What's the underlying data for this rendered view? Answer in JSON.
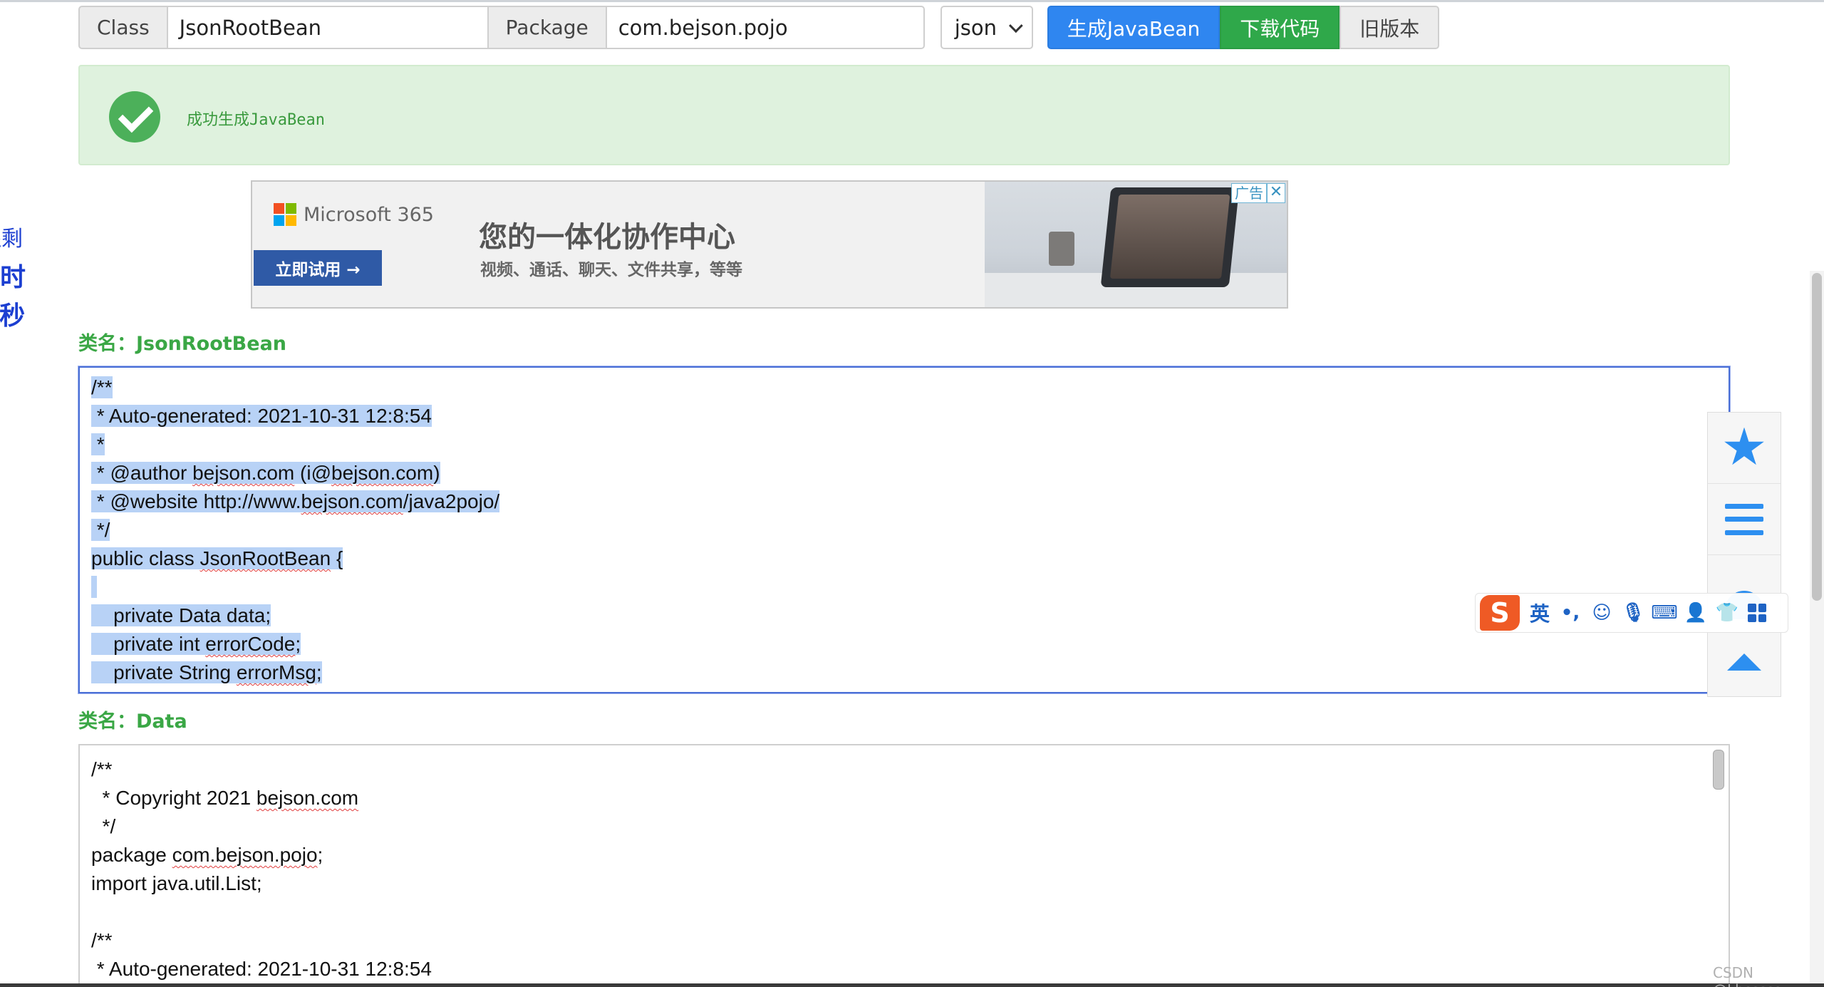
{
  "toolbar": {
    "class_label": "Class",
    "class_value": "JsonRootBean",
    "package_label": "Package",
    "package_value": "com.bejson.pojo",
    "format_select": "json",
    "generate_button": "生成JavaBean",
    "download_button": "下载代码",
    "old_version_button": "旧版本"
  },
  "alert": {
    "message": "成功生成JavaBean"
  },
  "ad": {
    "brand": "Microsoft 365",
    "cta": "立即试用 →",
    "headline": "您的一体化协作中心",
    "subline": "视频、通话、聊天、文件共享，等等",
    "tag": "广告",
    "close": "✕"
  },
  "left_stub": {
    "line1": "还剩",
    "line2": "小时",
    "line3": "/秒"
  },
  "sections": [
    {
      "label": "类名：JsonRootBean"
    },
    {
      "label": "类名：Data"
    }
  ],
  "code_root": {
    "lines": [
      "/**",
      " * Auto-generated: 2021-10-31 12:8:54",
      " *",
      " * @author bejson.com (i@bejson.com)",
      " * @website http://www.bejson.com/java2pojo/",
      " */",
      "public class JsonRootBean {",
      "",
      "    private Data data;",
      "    private int errorCode;",
      "    private String errorMsg;"
    ]
  },
  "code_data": {
    "lines": [
      "/**",
      "  * Copyright 2021 bejson.com",
      "  */",
      "package com.bejson.pojo;",
      "import java.util.List;",
      "",
      "/**",
      " * Auto-generated: 2021-10-31 12:8:54"
    ]
  },
  "ime": {
    "logo": "S",
    "lang": "英",
    "punct": "•,"
  },
  "watermark": "CSDN @Lbsssss",
  "colors": {
    "accent_blue": "#2f86f0",
    "accent_green": "#2fa84a",
    "success_bg": "#dff2de",
    "label_green": "#3aa745",
    "selection": "#b8d2f6"
  },
  "icons": [
    "check-icon",
    "star-icon",
    "menu-icon",
    "bell-icon",
    "up-arrow-icon",
    "chevron-down-icon"
  ]
}
